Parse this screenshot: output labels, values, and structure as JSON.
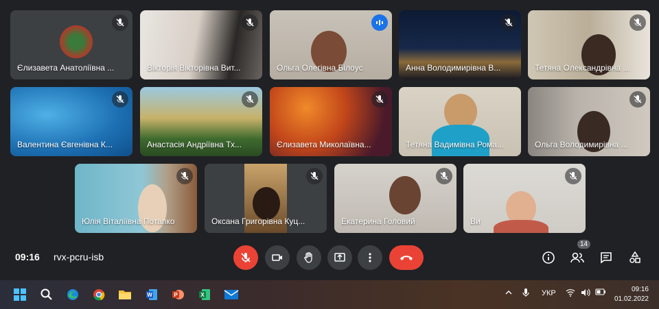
{
  "meeting": {
    "time": "09:16",
    "code": "rvx-pcru-isb",
    "participants_count": "14"
  },
  "tiles": [
    {
      "name": "Єлизавета Анатоліївна ...",
      "status": "muted"
    },
    {
      "name": "Вікторія Вікторівна Вит...",
      "status": "muted"
    },
    {
      "name": "Ольга Олегівна Білоус",
      "status": "speaking"
    },
    {
      "name": "Анна Володимирівна В...",
      "status": "muted"
    },
    {
      "name": "Тетяна Олександрівна ...",
      "status": "muted"
    },
    {
      "name": "Валентина Євгенівна К...",
      "status": "muted"
    },
    {
      "name": "Анастасія Андріївна Тх...",
      "status": "muted"
    },
    {
      "name": "Єлизавета Миколаївна...",
      "status": "muted"
    },
    {
      "name": "Тетяна Вадимівна Рома...",
      "status": "muted"
    },
    {
      "name": "Ольга Володимирівна ...",
      "status": "muted"
    },
    {
      "name": "Юлія Віталіївна Потапко",
      "status": "muted"
    },
    {
      "name": "Оксана Григорівна Куц...",
      "status": "muted"
    },
    {
      "name": "Екатерина Головий",
      "status": "muted"
    },
    {
      "name": "Ви",
      "status": "muted"
    }
  ],
  "controls": [
    "mic-off-icon",
    "camera-icon",
    "raise-hand-icon",
    "present-icon",
    "more-icon",
    "hang-up-icon"
  ],
  "right_controls": [
    "info-icon",
    "people-icon",
    "chat-icon",
    "activities-icon"
  ],
  "taskbar": {
    "apps": [
      "windows-start-icon",
      "search-icon",
      "edge-icon",
      "chrome-icon",
      "file-explorer-icon",
      "word-icon",
      "powerpoint-icon",
      "excel-icon",
      "mail-icon"
    ],
    "language": "УКР",
    "time": "09:16",
    "date": "01.02.2022"
  },
  "colors": {
    "background": "#202124",
    "danger": "#ea4335",
    "speaking": "#1a73e8",
    "highlight": "#8ab4f8"
  }
}
